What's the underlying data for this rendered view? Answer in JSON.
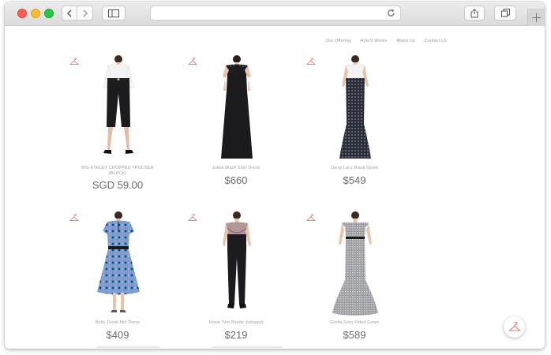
{
  "nav": {
    "items": [
      "Our Offering",
      "How It Works",
      "About Us",
      "Contact Us"
    ]
  },
  "products": [
    {
      "name": "BIG EYELET CROPPED TROUSER (BLACK)",
      "price": "SGD 59.00"
    },
    {
      "name": "Joline Black Shirt Dress",
      "price": "$660"
    },
    {
      "name": "Daisy Lacy Black Gown",
      "price": "$549"
    },
    {
      "name": "Betty Floral Mid Dress",
      "price": "$409"
    },
    {
      "name": "Rosie Two Shade Jumpsuit",
      "price": "$219"
    },
    {
      "name": "Gretia Grey Fitted Gown",
      "price": "$589"
    }
  ],
  "icons": {
    "accent": "#e8837d",
    "hanger": "hanger-icon"
  }
}
